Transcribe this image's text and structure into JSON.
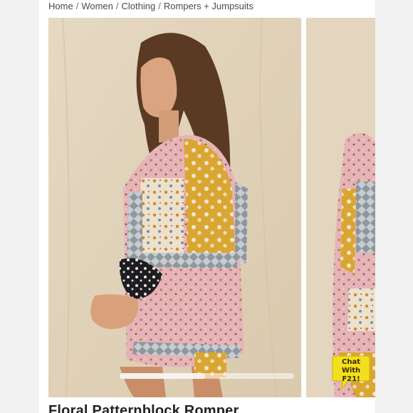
{
  "breadcrumb": {
    "items": [
      "Home",
      "Women",
      "Clothing",
      "Rompers + Jumpsuits"
    ],
    "separator": "/"
  },
  "gallery": {
    "image_alt": "Model wearing a floral patchwork romper with long sleeves",
    "slide_count_visible": 2
  },
  "chat": {
    "line1": "Chat With",
    "line2": "F21!",
    "icon": "chat-bubble-icon",
    "color": "#f4df1e"
  },
  "product": {
    "title": "Floral Patternblock Romper"
  }
}
